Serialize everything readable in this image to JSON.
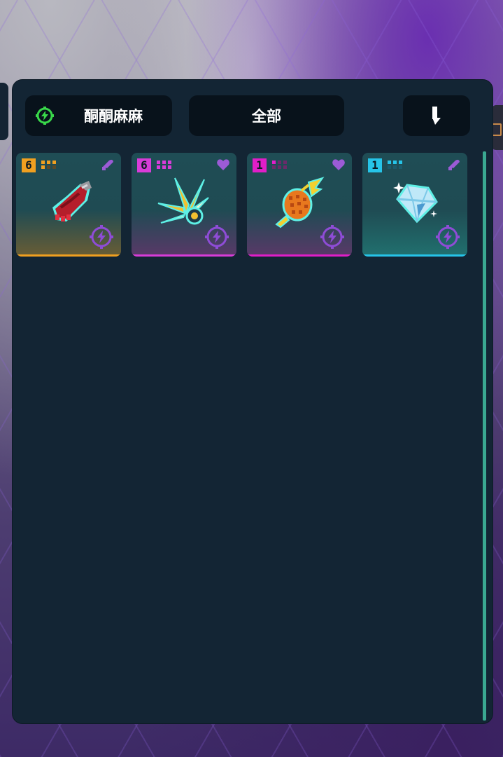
{
  "filters": {
    "category_label": "酮酮麻麻",
    "all_label": "全部"
  },
  "items": [
    {
      "level": "6",
      "rarity_color": "#f0a020",
      "tint": "#6a5d34",
      "tag": "bullet-icon",
      "tag_color": "#9b5bd6",
      "art": "crimson-gauntlet"
    },
    {
      "level": "6",
      "rarity_color": "#d83cd8",
      "tint": "#5a3868",
      "tag": "heart-icon",
      "tag_color": "#9b5bd6",
      "art": "spike-burst"
    },
    {
      "level": "1",
      "rarity_color": "#e01ec8",
      "tint": "#5a3868",
      "tag": "heart-icon",
      "tag_color": "#9b5bd6",
      "art": "fire-pinecone"
    },
    {
      "level": "1",
      "rarity_color": "#26c4e8",
      "tint": "#21716f",
      "tag": "bullet-icon",
      "tag_color": "#9b5bd6",
      "art": "diamond"
    }
  ],
  "colors": {
    "panel": "#132534",
    "pill": "#08121b",
    "scrollbar": "#3aa891",
    "energy": "#8e4cd6",
    "lightning": "#39d84a"
  }
}
